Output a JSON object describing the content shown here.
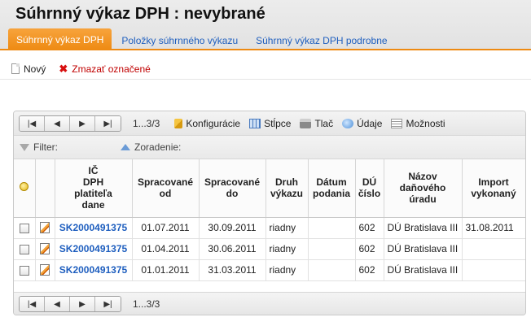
{
  "page": {
    "title": "Súhrnný výkaz DPH :  nevybrané"
  },
  "tabs": [
    {
      "label": "Súhrnný výkaz DPH",
      "active": true
    },
    {
      "label": "Položky súhrnného výkazu",
      "active": false
    },
    {
      "label": "Súhrnný výkaz DPH podrobne",
      "active": false
    }
  ],
  "toolbar": {
    "new_label": "Nový",
    "delete_label": "Zmazať označené"
  },
  "pager": {
    "info": "1...3/3",
    "first": "|◀",
    "prev": "◀",
    "next": "▶",
    "last": "▶|",
    "actions": [
      {
        "label": "Konfigurácie",
        "icon": "config-icon"
      },
      {
        "label": "Stĺpce",
        "icon": "columns-icon"
      },
      {
        "label": "Tlač",
        "icon": "print-icon"
      },
      {
        "label": "Údaje",
        "icon": "data-icon"
      },
      {
        "label": "Možnosti",
        "icon": "options-icon"
      }
    ]
  },
  "filterbar": {
    "filter_label": "Filter:",
    "sort_label": "Zoradenie:"
  },
  "table": {
    "columns": [
      "",
      "",
      "IČ DPH platiteľa dane",
      "Spracované od",
      "Spracované do",
      "Druh výkazu",
      "Dátum podania",
      "DÚ číslo",
      "Názov daňového úradu",
      "Import vykonaný"
    ],
    "col_lines": [
      [],
      [],
      [
        "IČ",
        "DPH",
        "platiteľa",
        "dane"
      ],
      [
        "Spracované",
        "od"
      ],
      [
        "Spracované",
        "do"
      ],
      [
        "Druh",
        "výkazu"
      ],
      [
        "Dátum",
        "podania"
      ],
      [
        "DÚ",
        "číslo"
      ],
      [
        "Názov",
        "daňového",
        "úradu"
      ],
      [
        "Import",
        "vykonaný"
      ]
    ],
    "rows": [
      {
        "ic": "SK2000491375",
        "od": "01.07.2011",
        "do": "30.09.2011",
        "druh": "riadny",
        "datum": "",
        "du": "602",
        "urad": "DÚ Bratislava III",
        "import": "31.08.2011"
      },
      {
        "ic": "SK2000491375",
        "od": "01.04.2011",
        "do": "30.06.2011",
        "druh": "riadny",
        "datum": "",
        "du": "602",
        "urad": "DÚ Bratislava III",
        "import": ""
      },
      {
        "ic": "SK2000491375",
        "od": "01.01.2011",
        "do": "31.03.2011",
        "druh": "riadny",
        "datum": "",
        "du": "602",
        "urad": "DÚ Bratislava III",
        "import": ""
      }
    ]
  },
  "colors": {
    "accent_tab": "#ee8a12",
    "link": "#1f5fbf",
    "delete": "#c00000"
  }
}
